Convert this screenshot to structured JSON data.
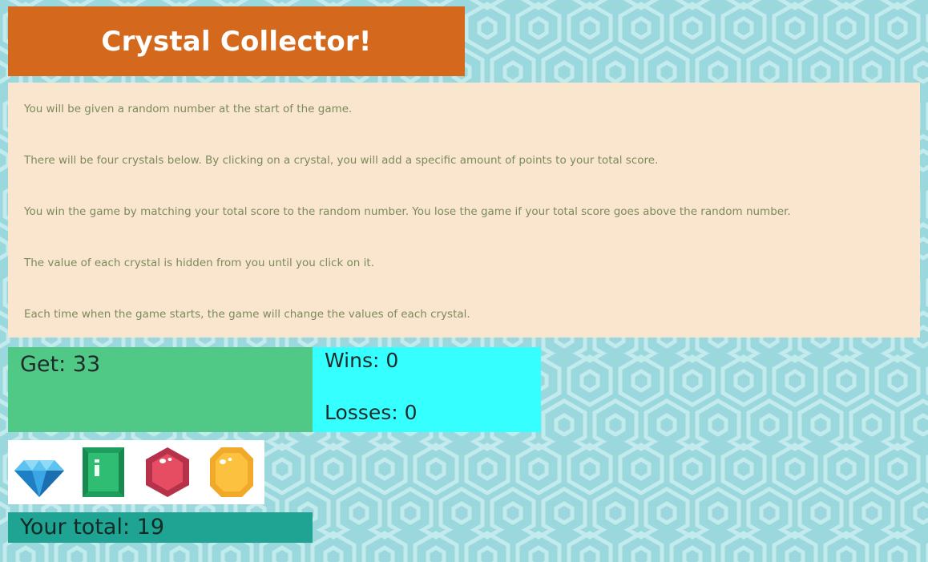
{
  "header": {
    "title": "Crystal Collector!"
  },
  "instructions": [
    "You will be given a random number at the start of the game.",
    "There will be four crystals below. By clicking on a crystal, you will add a specific amount of points to your total score.",
    "You win the game by matching your total score to the random number. You lose the game if your total score goes above the random number.",
    "The value of each crystal is hidden from you until you click on it.",
    "Each time when the game starts, the game will change the values of each crystal."
  ],
  "target": {
    "label": "Get: 33"
  },
  "scoreboard": {
    "wins": "Wins: 0",
    "losses": "Losses: 0"
  },
  "crystals": [
    {
      "icon": "blue-diamond-icon"
    },
    {
      "icon": "green-emerald-icon"
    },
    {
      "icon": "red-ruby-icon"
    },
    {
      "icon": "yellow-topaz-icon"
    }
  ],
  "total": {
    "label": "Your total: 19"
  },
  "colors": {
    "background": "#9bd8dd",
    "title_bg": "#d4691e",
    "instructions_bg": "#fae6ce",
    "instructions_text": "#7b8a5c",
    "target_bg": "#51c986",
    "score_bg": "#36ffff",
    "total_bg": "#1fa393"
  }
}
